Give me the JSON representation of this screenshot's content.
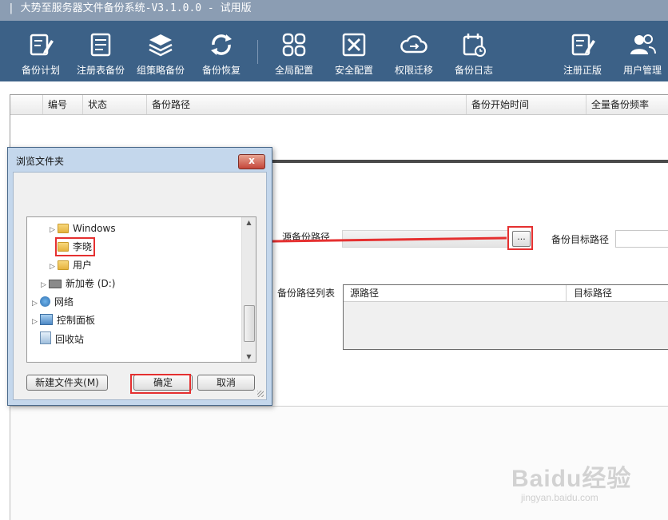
{
  "window": {
    "title": "| 大势至服务器文件备份系统-V3.1.0.0 - 试用版"
  },
  "toolbar": {
    "buttons": [
      {
        "label": "备份计划",
        "icon": "edit-doc-icon"
      },
      {
        "label": "注册表备份",
        "icon": "document-icon"
      },
      {
        "label": "组策略备份",
        "icon": "layers-icon"
      },
      {
        "label": "备份恢复",
        "icon": "refresh-icon"
      },
      {
        "label": "全局配置",
        "icon": "grid-icon"
      },
      {
        "label": "安全配置",
        "icon": "tools-icon"
      },
      {
        "label": "权限迁移",
        "icon": "cloud-transfer-icon"
      },
      {
        "label": "备份日志",
        "icon": "calendar-log-icon"
      },
      {
        "label": "注册正版",
        "icon": "register-icon"
      },
      {
        "label": "用户管理",
        "icon": "users-icon"
      }
    ]
  },
  "grid": {
    "columns": [
      "编号",
      "状态",
      "备份路径",
      "备份开始时间",
      "全量备份频率"
    ]
  },
  "backup_form": {
    "source_label": "源备份路径",
    "browse_label": "...",
    "target_label": "备份目标路径",
    "list_label": "备份路径列表",
    "list_columns": [
      "源路径",
      "目标路径"
    ]
  },
  "dialog": {
    "title": "浏览文件夹",
    "close_label": "x",
    "tree": [
      {
        "label": "Windows",
        "expandable": true
      },
      {
        "label": "李晓",
        "expandable": false
      },
      {
        "label": "用户",
        "expandable": true
      },
      {
        "label": "新加卷 (D:)",
        "expandable": true
      },
      {
        "label": "网络",
        "expandable": true
      },
      {
        "label": "控制面板",
        "expandable": true
      },
      {
        "label": "回收站",
        "expandable": false
      }
    ],
    "new_folder_label": "新建文件夹(M)",
    "ok_label": "确定",
    "cancel_label": "取消"
  },
  "watermark": {
    "brand": "Baidu经验",
    "url": "jingyan.baidu.com"
  },
  "colors": {
    "toolbar": "#3c6187",
    "titlebar": "#8b9db3",
    "highlight": "#e53030"
  }
}
